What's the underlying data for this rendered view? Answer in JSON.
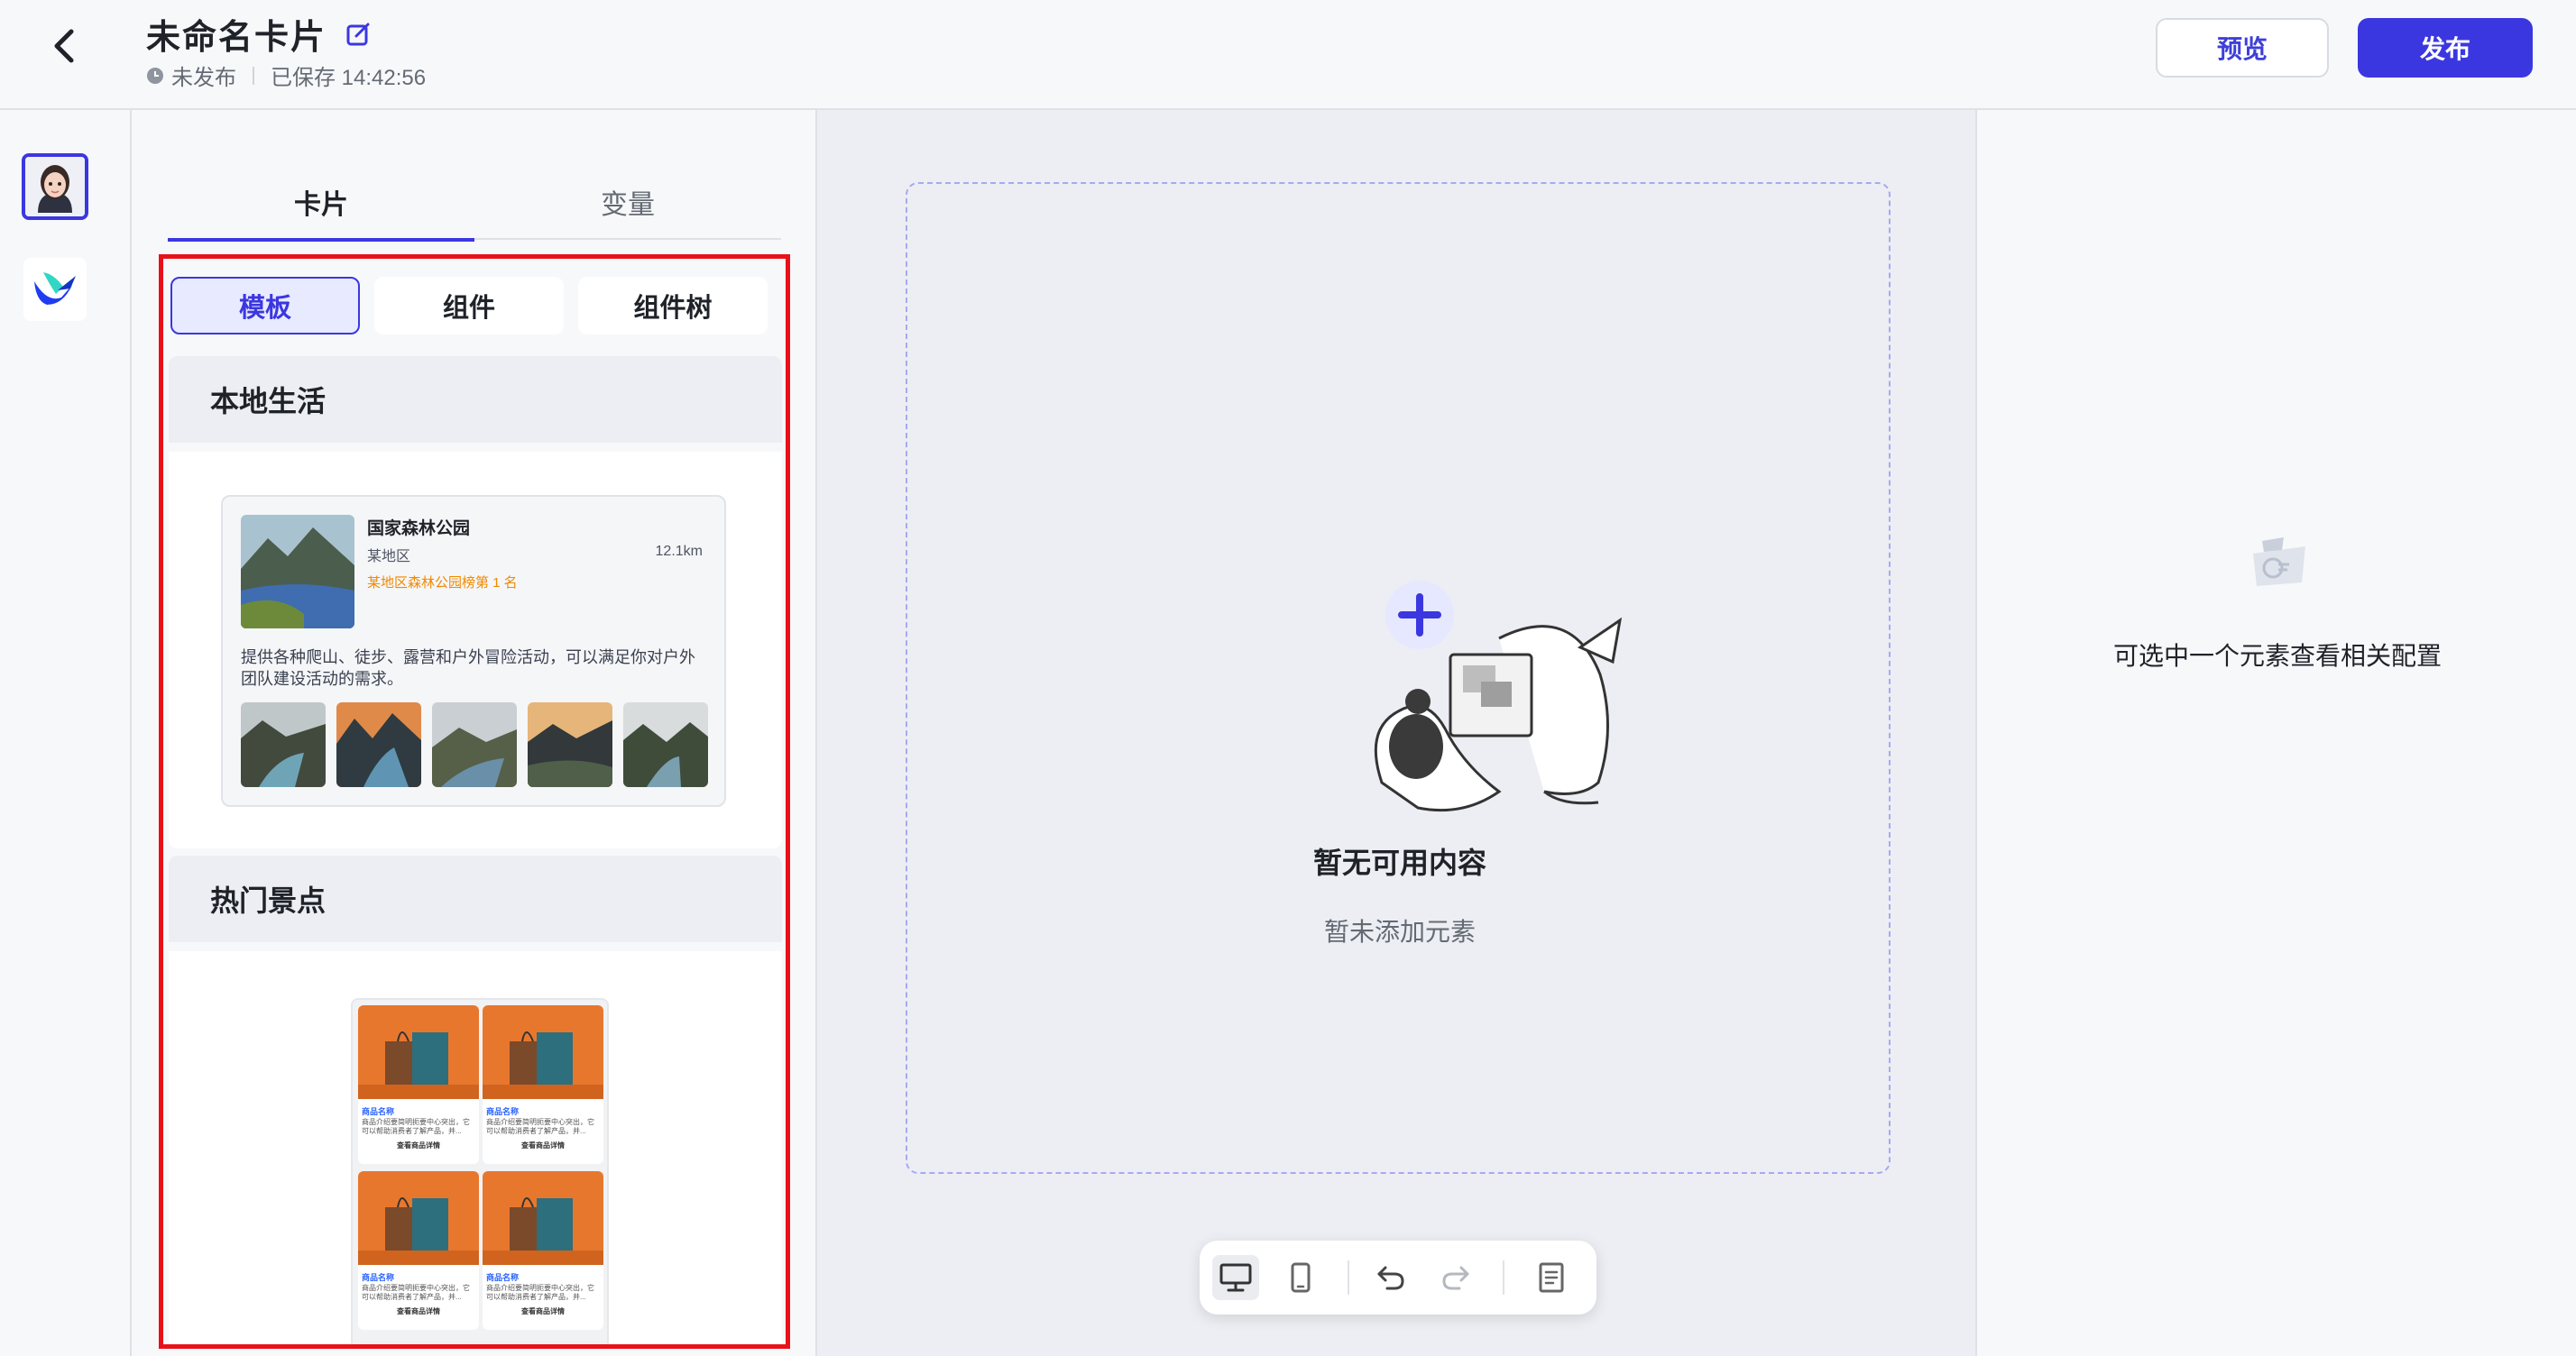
{
  "header": {
    "title": "未命名卡片",
    "publish_status": "未发布",
    "saved_text": "已保存 14:42:56",
    "preview_label": "预览",
    "publish_label": "发布"
  },
  "panel": {
    "tabs": [
      {
        "label": "卡片",
        "active": true
      },
      {
        "label": "变量",
        "active": false
      }
    ],
    "segments": [
      {
        "label": "模板",
        "active": true
      },
      {
        "label": "组件",
        "active": false
      },
      {
        "label": "组件树",
        "active": false
      }
    ],
    "sections": [
      {
        "title": "本地生活",
        "template": {
          "title": "国家森林公园",
          "region": "某地区",
          "distance": "12.1km",
          "rank": "某地区森林公园榜第 1 名",
          "description": "提供各种爬山、徒步、露营和户外冒险活动，可以满足你对户外团队建设活动的需求。"
        }
      },
      {
        "title": "热门景点",
        "products": [
          {
            "name": "商品名称",
            "desc": "商品介绍要简明扼要中心突出，它可以帮助消费者了解产品，并...",
            "button": "查看商品详情"
          },
          {
            "name": "商品名称",
            "desc": "商品介绍要简明扼要中心突出，它可以帮助消费者了解产品，并...",
            "button": "查看商品详情"
          },
          {
            "name": "商品名称",
            "desc": "商品介绍要简明扼要中心突出，它可以帮助消费者了解产品，并...",
            "button": "查看商品详情"
          },
          {
            "name": "商品名称",
            "desc": "商品介绍要简明扼要中心突出，它可以帮助消费者了解产品，并...",
            "button": "查看商品详情"
          }
        ]
      }
    ]
  },
  "canvas": {
    "empty_title": "暂无可用内容",
    "empty_subtitle": "暂未添加元素",
    "toolbar": [
      "desktop-icon",
      "mobile-icon",
      "undo-icon",
      "redo-icon",
      "document-icon"
    ]
  },
  "right_panel": {
    "hint": "可选中一个元素查看相关配置"
  },
  "colors": {
    "accent": "#3b37e0",
    "highlight_border": "#e8111a",
    "rank_text": "#f08a00"
  }
}
